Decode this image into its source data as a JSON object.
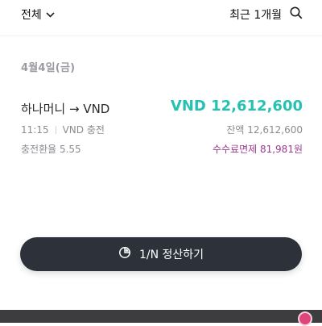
{
  "topbar": {
    "filter_label": "전체",
    "filter_icon": "chevron-down-icon",
    "period_label": "최근 1개월",
    "search_icon": "search-icon"
  },
  "section": {
    "date": "4월4일(금)"
  },
  "transaction": {
    "title": "하나머니 → VND",
    "amount": "VND 12,612,600",
    "time": "11:15",
    "type": "VND 충전",
    "balance": "잔액 12,612,600",
    "rate": "충전환율 5.55",
    "fee": "수수료면제 81,981원"
  },
  "settle_button": {
    "label": "1/N 정산하기",
    "icon": "split-pie-icon"
  },
  "colors": {
    "amount": "#26c2b1",
    "fee": "#9c3b8c",
    "button": "#2c313a"
  }
}
